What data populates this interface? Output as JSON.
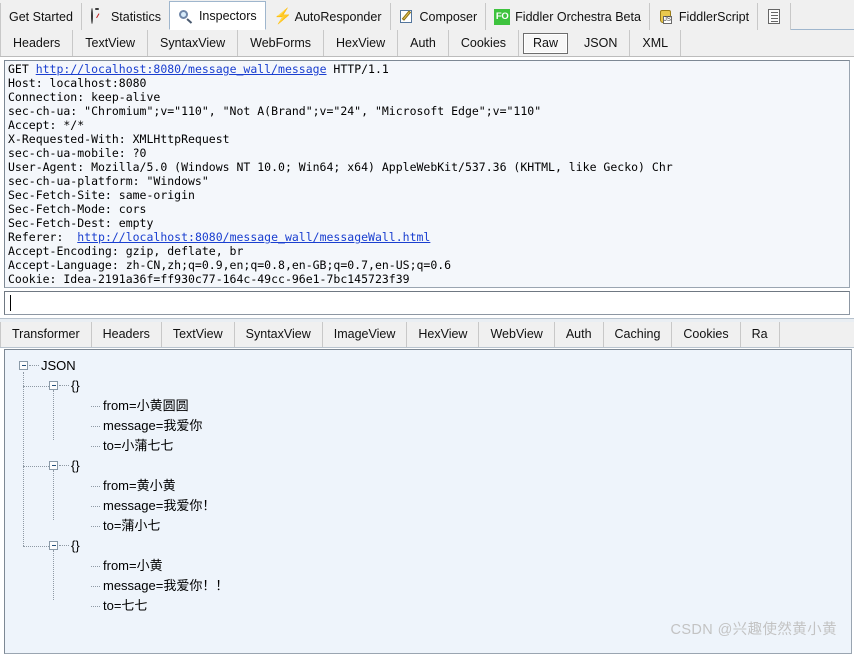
{
  "main_tabs": [
    {
      "label": "Get Started",
      "icon": "none",
      "selected": false
    },
    {
      "label": "Statistics",
      "icon": "clock-icon",
      "selected": false
    },
    {
      "label": "Inspectors",
      "icon": "magnifier-icon",
      "selected": true
    },
    {
      "label": "AutoResponder",
      "icon": "bolt-icon",
      "selected": false
    },
    {
      "label": "Composer",
      "icon": "compose-icon",
      "selected": false
    },
    {
      "label": "Fiddler Orchestra Beta",
      "icon": "fo-icon",
      "selected": false
    },
    {
      "label": "FiddlerScript",
      "icon": "fiddlerscript-icon",
      "selected": false
    },
    {
      "label": "",
      "icon": "log-icon",
      "selected": false
    }
  ],
  "request_tabs": [
    {
      "label": "Headers",
      "selected": false
    },
    {
      "label": "TextView",
      "selected": false
    },
    {
      "label": "SyntaxView",
      "selected": false
    },
    {
      "label": "WebForms",
      "selected": false
    },
    {
      "label": "HexView",
      "selected": false
    },
    {
      "label": "Auth",
      "selected": false
    },
    {
      "label": "Cookies",
      "selected": false
    },
    {
      "label": "Raw",
      "selected": true
    },
    {
      "label": "JSON",
      "selected": false
    },
    {
      "label": "XML",
      "selected": false
    }
  ],
  "request_raw": {
    "lines": [
      {
        "pre": "GET ",
        "url": "http://localhost:8080/message_wall/message",
        "post": " HTTP/1.1"
      },
      {
        "pre": "Host: localhost:8080",
        "url": "",
        "post": ""
      },
      {
        "pre": "Connection: keep-alive",
        "url": "",
        "post": ""
      },
      {
        "pre": "sec-ch-ua: \"Chromium\";v=\"110\", \"Not A(Brand\";v=\"24\", \"Microsoft Edge\";v=\"110\"",
        "url": "",
        "post": ""
      },
      {
        "pre": "Accept: */*",
        "url": "",
        "post": ""
      },
      {
        "pre": "X-Requested-With: XMLHttpRequest",
        "url": "",
        "post": ""
      },
      {
        "pre": "sec-ch-ua-mobile: ?0",
        "url": "",
        "post": ""
      },
      {
        "pre": "User-Agent: Mozilla/5.0 (Windows NT 10.0; Win64; x64) AppleWebKit/537.36 (KHTML, like Gecko) Chr",
        "url": "",
        "post": ""
      },
      {
        "pre": "sec-ch-ua-platform: \"Windows\"",
        "url": "",
        "post": ""
      },
      {
        "pre": "Sec-Fetch-Site: same-origin",
        "url": "",
        "post": ""
      },
      {
        "pre": "Sec-Fetch-Mode: cors",
        "url": "",
        "post": ""
      },
      {
        "pre": "Sec-Fetch-Dest: empty",
        "url": "",
        "post": ""
      },
      {
        "pre": "Referer:  ",
        "url": "http://localhost:8080/message_wall/messageWall.html",
        "post": ""
      },
      {
        "pre": "Accept-Encoding: gzip, deflate, br",
        "url": "",
        "post": ""
      },
      {
        "pre": "Accept-Language: zh-CN,zh;q=0.9,en;q=0.8,en-GB;q=0.7,en-US;q=0.6",
        "url": "",
        "post": ""
      },
      {
        "pre": "Cookie: Idea-2191a36f=ff930c77-164c-49cc-96e1-7bc145723f39",
        "url": "",
        "post": ""
      }
    ],
    "input_value": ""
  },
  "response_tabs": [
    {
      "label": "Transformer",
      "selected": false
    },
    {
      "label": "Headers",
      "selected": false
    },
    {
      "label": "TextView",
      "selected": false
    },
    {
      "label": "SyntaxView",
      "selected": false
    },
    {
      "label": "ImageView",
      "selected": false
    },
    {
      "label": "HexView",
      "selected": false
    },
    {
      "label": "WebView",
      "selected": false
    },
    {
      "label": "Auth",
      "selected": false
    },
    {
      "label": "Caching",
      "selected": false
    },
    {
      "label": "Cookies",
      "selected": false
    },
    {
      "label": "Ra",
      "selected": false
    }
  ],
  "json_tree": {
    "root_label": "JSON",
    "objects": [
      {
        "label": "{}",
        "fields": [
          "from=小黄圆圆",
          "message=我爱你",
          "to=小蒲七七"
        ]
      },
      {
        "label": "{}",
        "fields": [
          "from=黄小黄",
          "message=我爱你！",
          "to=蒲小七"
        ]
      },
      {
        "label": "{}",
        "fields": [
          "from=小黄",
          "message=我爱你！！",
          "to=七七"
        ]
      }
    ]
  },
  "watermark": "CSDN @兴趣使然黄小黄",
  "colors": {
    "url_link": "#1a3fd0",
    "panel_bg": "#eef4fb",
    "tabstrip_bg": "#f0f0f0",
    "fo_badge": "#3ec33e",
    "watermark": "#c3c3c3"
  }
}
